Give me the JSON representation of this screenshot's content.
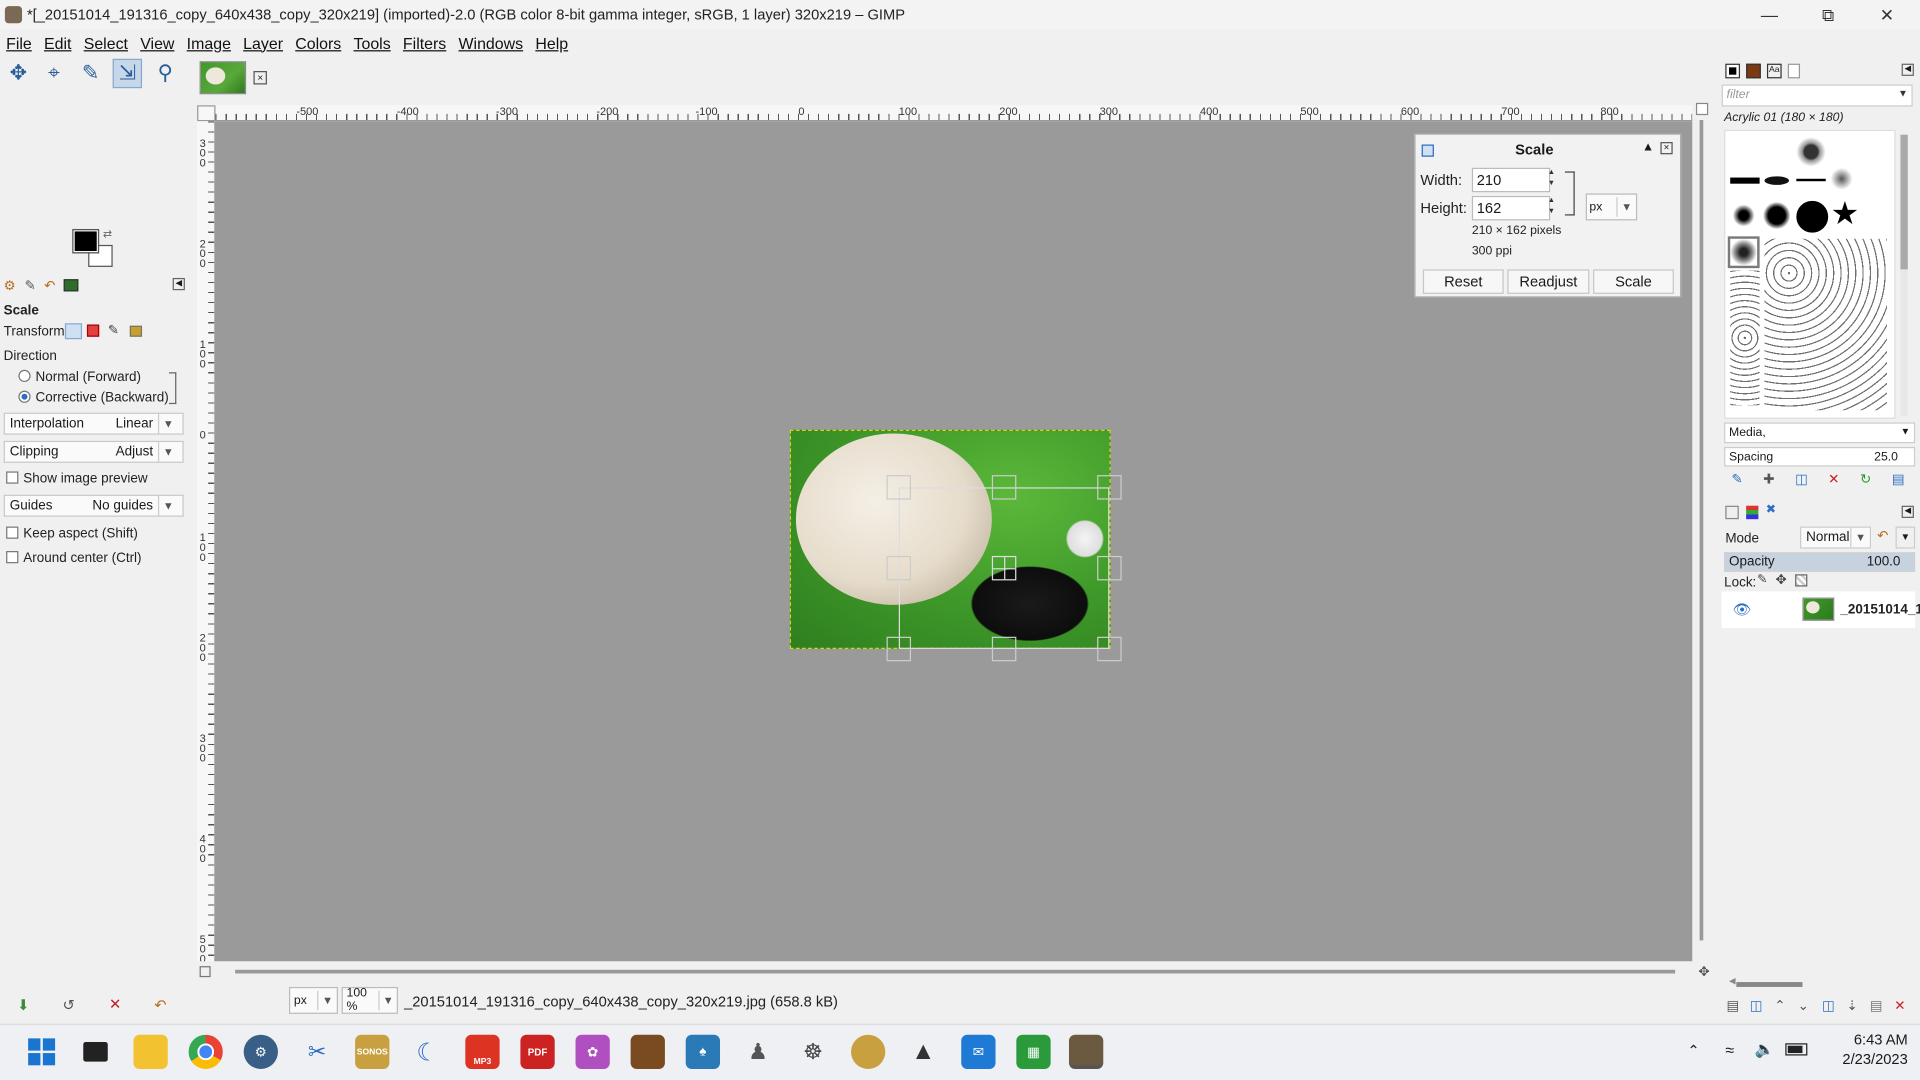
{
  "window": {
    "title": "*[_20151014_191316_copy_640x438_copy_320x219] (imported)-2.0 (RGB color 8-bit gamma integer, sRGB, 1 layer) 320x219 – GIMP"
  },
  "menu": [
    "File",
    "Edit",
    "Select",
    "View",
    "Image",
    "Layer",
    "Colors",
    "Tools",
    "Filters",
    "Windows",
    "Help"
  ],
  "toolbox": {
    "tool_title": "Scale",
    "transform_label": "Transform:",
    "direction_label": "Direction",
    "dir_forward": "Normal (Forward)",
    "dir_backward": "Corrective (Backward)",
    "interpolation_label": "Interpolation",
    "interpolation_value": "Linear",
    "clipping_label": "Clipping",
    "clipping_value": "Adjust",
    "show_preview": "Show image preview",
    "guides_label": "Guides",
    "guides_value": "No guides",
    "keep_aspect": "Keep aspect (Shift)",
    "around_center": "Around center (Ctrl)"
  },
  "rulers": {
    "top": [
      "-500",
      "-400",
      "-300",
      "-200",
      "-100",
      "0",
      "100",
      "200",
      "300",
      "400",
      "500",
      "600",
      "700",
      "800"
    ],
    "left": [
      "3 0 0",
      "2 0 0",
      "1 0 0",
      "0",
      "1 0 0",
      "2 0 0",
      "3 0 0",
      "4 0 0",
      "5 0 0"
    ]
  },
  "scale_dialog": {
    "title": "Scale",
    "width_label": "Width:",
    "width_value": "210",
    "height_label": "Height:",
    "height_value": "162",
    "unit": "px",
    "pixels_info": "210 × 162 pixels",
    "ppi_info": "300 ppi",
    "reset": "Reset",
    "readjust": "Readjust",
    "scale": "Scale"
  },
  "status": {
    "unit": "px",
    "zoom": "100 %",
    "file": "_20151014_191316_copy_640x438_copy_320x219.jpg (658.8 kB)"
  },
  "brushes": {
    "filter_placeholder": "filter",
    "brush_name": "Acrylic 01 (180 × 180)",
    "tag": "Media,",
    "spacing_label": "Spacing",
    "spacing_value": "25.0"
  },
  "layers": {
    "mode_label": "Mode",
    "mode_value": "Normal",
    "opacity_label": "Opacity",
    "opacity_value": "100.0",
    "lock_label": "Lock:",
    "layer_name": "_20151014_1"
  },
  "taskbar": {
    "time": "6:43 AM",
    "date": "2/23/2023",
    "app_labels": {
      "sonos": "SONOS",
      "pdf": "PDF",
      "mp3": "MP3"
    }
  },
  "colors": {
    "accent": "#2b6cc4",
    "canvas_bg": "#9a9a9a",
    "grass": "#3f9a2a"
  }
}
